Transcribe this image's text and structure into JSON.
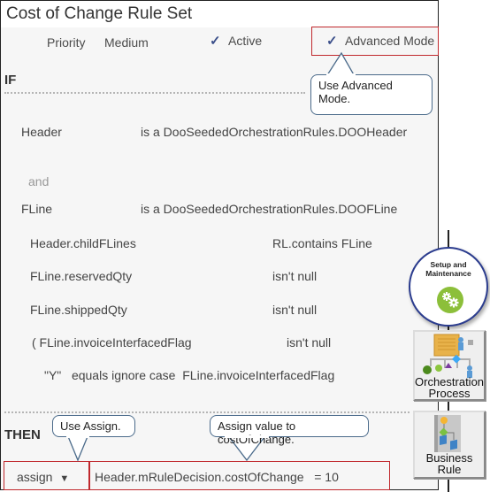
{
  "title": "Cost of Change Rule Set",
  "header": {
    "priority_label": "Priority",
    "priority_value": "Medium",
    "active_check": "✓",
    "active_label": "Active",
    "advanced_check": "✓",
    "advanced_label": "Advanced Mode"
  },
  "if_section": {
    "label": "IF",
    "patterns": [
      {
        "variable": "Header",
        "type": "is a DooSeededOrchestrationRules.DOOHeader"
      },
      {
        "variable": "FLine",
        "type": "is a DooSeededOrchestrationRules.DOOFLine"
      }
    ],
    "and_label": "and",
    "conditions": [
      {
        "left": "Header.childFLines",
        "right": "RL.contains FLine"
      },
      {
        "left": "FLine.reservedQty",
        "right": "isn't null"
      },
      {
        "left": "FLine.shippedQty",
        "right": "isn't null"
      },
      {
        "left": "( FLine.invoiceInterfacedFlag",
        "right": "isn't null"
      },
      {
        "left": "\"Y\"   equals ignore case  FLine.invoiceInterfacedFlag",
        "right": ""
      }
    ]
  },
  "then_section": {
    "label": "THEN",
    "action_select": "assign",
    "action_select_arrow": "▼",
    "action_expression": "Header.mRuleDecision.costOfChange   = 10"
  },
  "callouts": {
    "advanced_mode": "Use Advanced\nMode.",
    "assign": "Use Assign.",
    "assign_value": "Assign value  to costOfChange."
  },
  "sidebar": {
    "setup_maintenance": "Setup and\nMaintenance",
    "orchestration_process": "Orchestration\nProcess",
    "business_rule": "Business\nRule"
  },
  "colors": {
    "highlight_border": "#c0282d",
    "check_color": "#3b4f8a",
    "setup_green": "#8cbf3a",
    "setup_ring": "#2b3c8e"
  }
}
